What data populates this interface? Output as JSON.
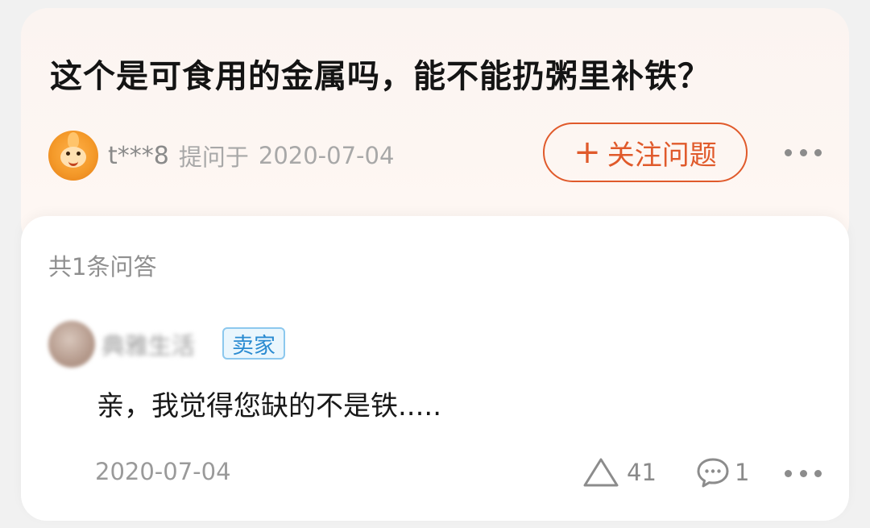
{
  "question": {
    "title": "这个是可食用的金属吗，能不能扔粥里补铁？",
    "asker_name": "t***8",
    "ask_label": "提问于",
    "ask_date": "2020-07-04",
    "follow_label": "关注问题",
    "follow_icon": "plus-icon",
    "more_icon": "more-icon",
    "accent_color": "#e05a2b"
  },
  "answers": {
    "count_label": "共1条问答",
    "items": [
      {
        "author_name": "典雅生活",
        "badge": "卖家",
        "text": "亲，我觉得您缺的不是铁.....",
        "date": "2020-07-04",
        "likes": "41",
        "comments": "1",
        "like_icon": "triangle-up-icon",
        "comment_icon": "comment-bubble-icon",
        "more_icon": "more-icon"
      }
    ]
  }
}
